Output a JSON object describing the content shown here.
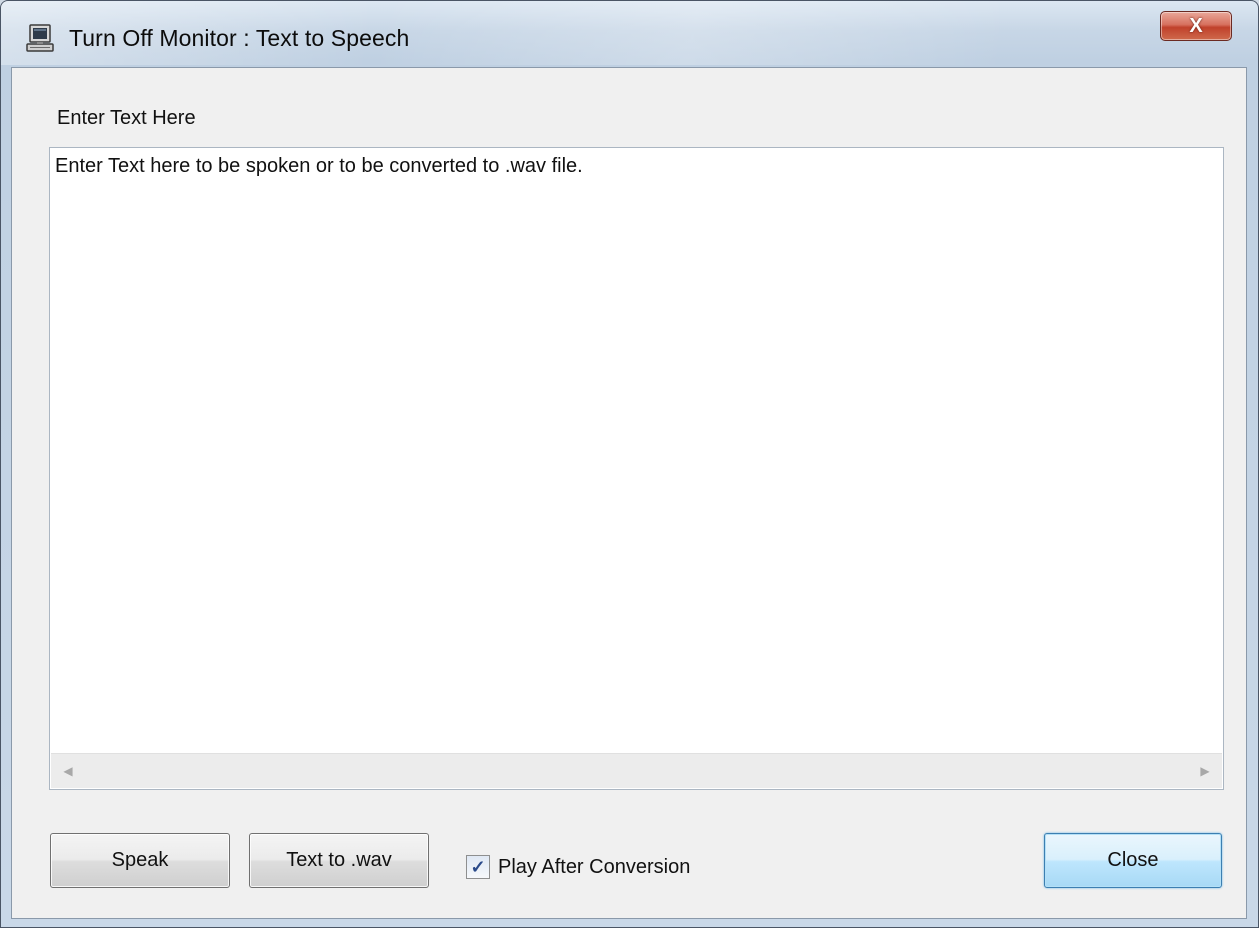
{
  "window": {
    "title": "Turn Off Monitor : Text to Speech",
    "app_icon": "computer-monitor-icon",
    "close_glyph": "X"
  },
  "main": {
    "prompt_label": "Enter Text Here",
    "text_content": "Enter Text here to be spoken or to be converted to .wav file.",
    "scroll_left_glyph": "◀",
    "scroll_right_glyph": "▶"
  },
  "buttons": {
    "speak": "Speak",
    "text_to_wav": "Text to .wav",
    "close": "Close"
  },
  "options": {
    "play_after_conversion_label": "Play After Conversion",
    "play_after_conversion_checked": true,
    "check_glyph": "✓"
  },
  "colors": {
    "close_button_accent": "#c0412b",
    "default_button_border": "#3c7fb1",
    "dialog_background": "#f0f0f0"
  }
}
